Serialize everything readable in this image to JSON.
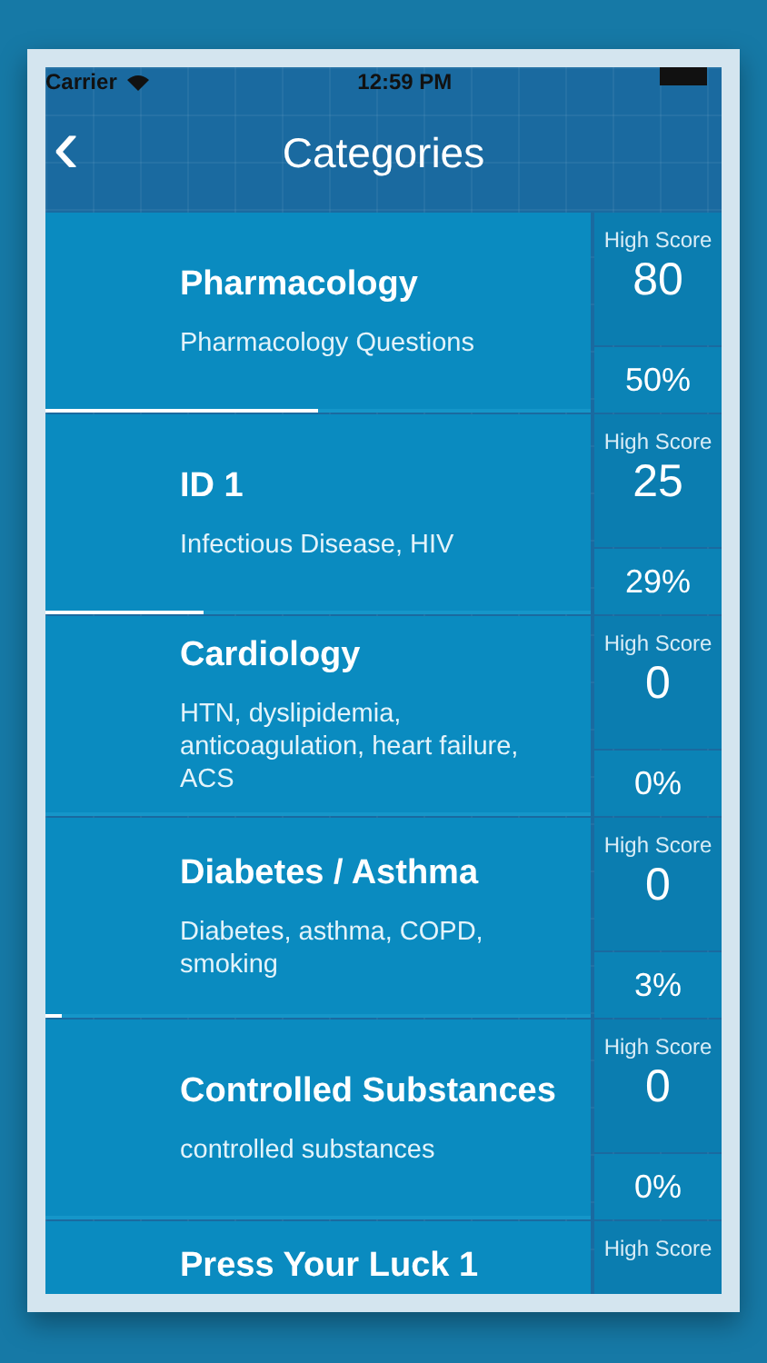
{
  "status_bar": {
    "carrier": "Carrier",
    "time": "12:59 PM"
  },
  "nav": {
    "back": "‹",
    "title": "Categories"
  },
  "categories": [
    {
      "title": "Pharmacology",
      "subtitle": "Pharmacology Questions",
      "high_score_label": "High Score",
      "high_score": "80",
      "percent": "50%",
      "level": 0.5
    },
    {
      "title": "ID 1",
      "subtitle": "Infectious Disease, HIV",
      "high_score_label": "High Score",
      "high_score": "25",
      "percent": "29%",
      "level": 0.29
    },
    {
      "title": "Cardiology",
      "subtitle": "HTN, dyslipidemia, anticoagulation, heart failure, ACS",
      "high_score_label": "High Score",
      "high_score": "0",
      "percent": "0%",
      "level": 0
    },
    {
      "title": "Diabetes / Asthma",
      "subtitle": "Diabetes, asthma, COPD, smoking",
      "high_score_label": "High Score",
      "high_score": "0",
      "percent": "3%",
      "level": 0.03
    },
    {
      "title": "Controlled Substances",
      "subtitle": "controlled substances",
      "high_score_label": "High Score",
      "high_score": "0",
      "percent": "0%",
      "level": 0
    },
    {
      "title": "Press Your Luck 1",
      "high_score_label": "High Score"
    }
  ]
}
